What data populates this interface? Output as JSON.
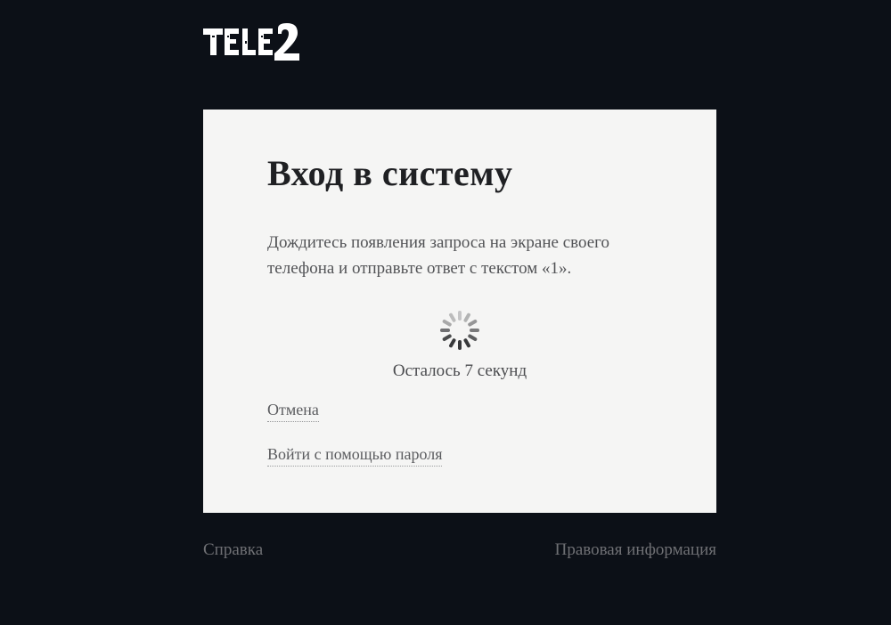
{
  "brand": "Tele2",
  "card": {
    "title": "Вход в систему",
    "instructions": "Дождитесь появления запроса на экране своего телефона и отправьте ответ с текстом «1».",
    "countdown": "Осталось 7 секунд",
    "cancel": "Отмена",
    "passwordLogin": "Войти с помощью пароля"
  },
  "footer": {
    "help": "Справка",
    "legal": "Правовая информация"
  }
}
